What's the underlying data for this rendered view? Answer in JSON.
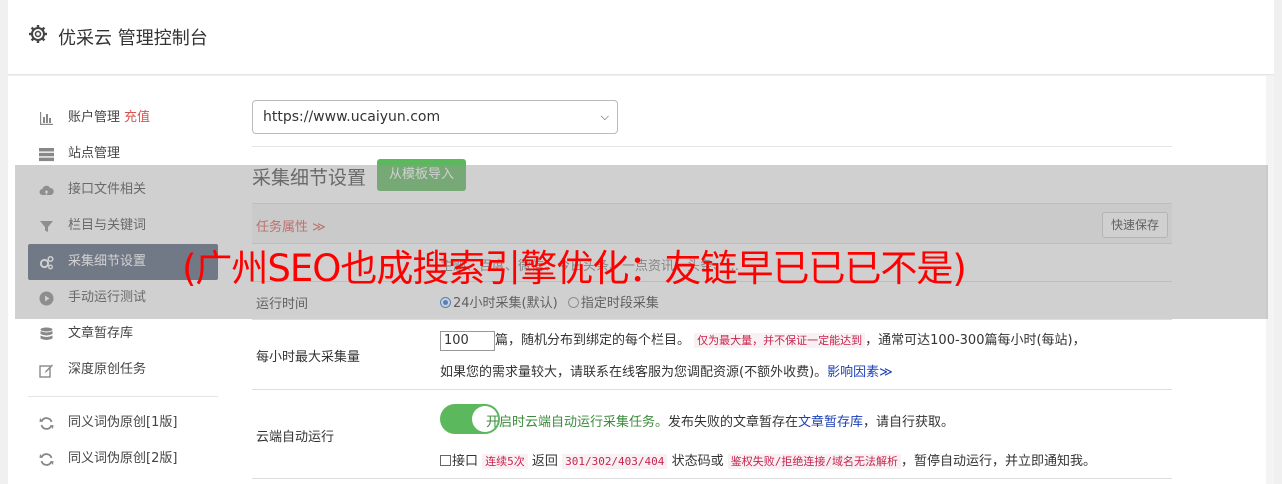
{
  "header": {
    "title": "优采云 管理控制台"
  },
  "sidebar": {
    "items": [
      {
        "label": "账户管理",
        "extra": "充值"
      },
      {
        "label": "站点管理"
      },
      {
        "label": "接口文件相关"
      },
      {
        "label": "栏目与关键词"
      },
      {
        "label": "采集细节设置"
      },
      {
        "label": "手动运行测试"
      },
      {
        "label": "文章暂存库"
      },
      {
        "label": "深度原创任务"
      },
      {
        "label": "同义词伪原创[1版]"
      },
      {
        "label": "同义词伪原创[2版]"
      }
    ]
  },
  "main": {
    "url_value": "https://www.ucaiyun.com",
    "section_title": "采集细节设置",
    "import_button": "从模板导入",
    "task_attr": "任务属性 ≫",
    "quick_save": "快速保存",
    "row1_text": "主题、百度、微信、今日头条、一点资讯、头条、…",
    "run_time_label": "运行时间",
    "run_opt1": "24小时采集(默认)",
    "run_opt2": "指定时段采集",
    "max_label": "每小时最大采集量",
    "max_value": "100",
    "max_text1": "篇，随机分布到绑定的每个栏目。",
    "max_tag": "仅为最大量，并不保证一定能达到",
    "max_text2": "，通常可达100-300篇每小时(每站)，",
    "max_text3": "如果您的需求量较大，请联系在线客服为您调配资源(不额外收费)。",
    "max_link": "影响因素≫",
    "cloud_label": "云端自动运行",
    "cloud_green": "开启时云端自动运行采集任务。",
    "cloud_text1": "发布失败的文章暂存在",
    "cloud_link": "文章暂存库",
    "cloud_text2": "，请自行获取。",
    "iface_text1": "接口",
    "iface_tag1": "连续5次",
    "iface_text2": "返回",
    "iface_tag2": "301/302/403/404",
    "iface_text3": "状态码或",
    "iface_tag3": "鉴权失败/拒绝连接/域名无法解析",
    "iface_text4": "，暂停自动运行，并立即通知我。"
  },
  "overlay": {
    "text": "(广州SEO也成搜索引擎优化：友链早已已已不是)"
  }
}
